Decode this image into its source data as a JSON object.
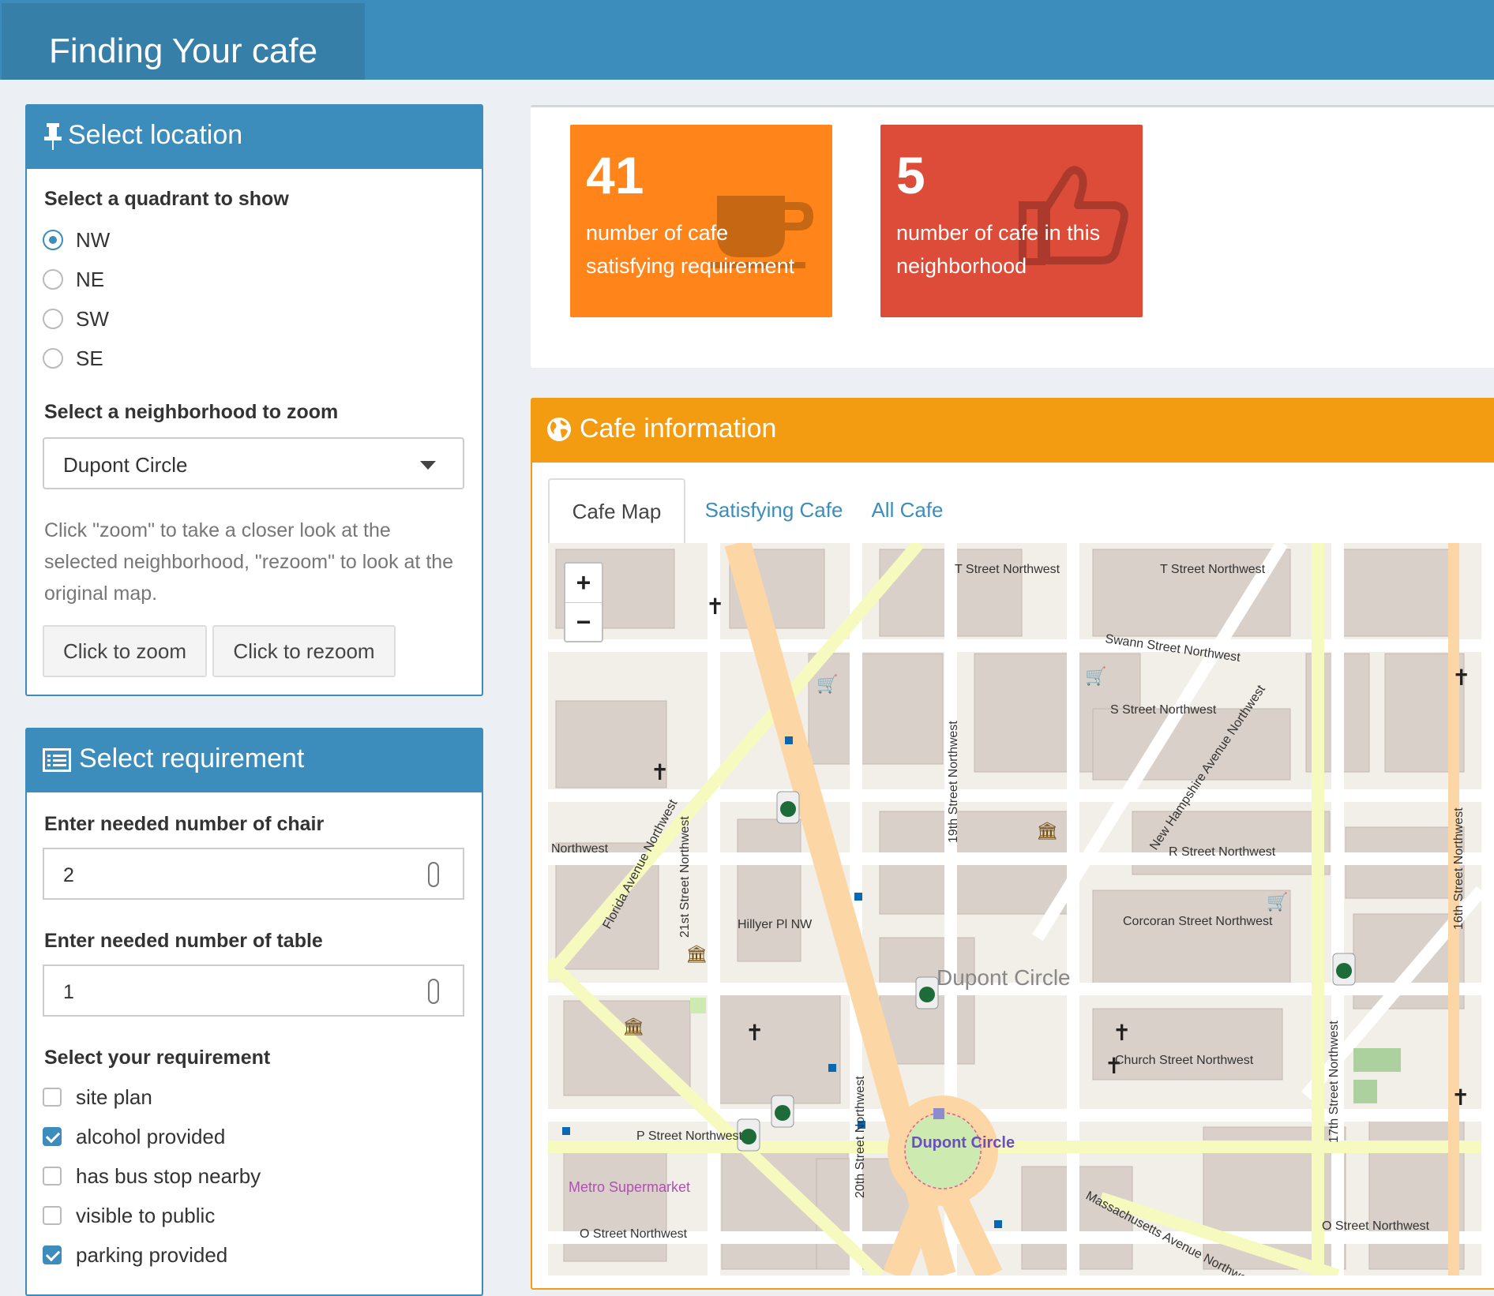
{
  "header": {
    "title": "Finding Your cafe"
  },
  "location_box": {
    "title": "Select location",
    "quadrant_label": "Select a quadrant to show",
    "quadrants": [
      {
        "label": "NW",
        "selected": true
      },
      {
        "label": "NE",
        "selected": false
      },
      {
        "label": "SW",
        "selected": false
      },
      {
        "label": "SE",
        "selected": false
      }
    ],
    "neighborhood_label": "Select a neighborhood to zoom",
    "neighborhood_value": "Dupont Circle",
    "help_text": "Click \"zoom\" to take a closer look at the selected neighborhood, \"rezoom\" to look at the original map.",
    "zoom_button": "Click to zoom",
    "rezoom_button": "Click to rezoom"
  },
  "requirement_box": {
    "title": "Select requirement",
    "chair_label": "Enter needed number of chair",
    "chair_value": "2",
    "table_label": "Enter needed number of table",
    "table_value": "1",
    "requirement_label": "Select your requirement",
    "requirements": [
      {
        "label": "site plan",
        "checked": false
      },
      {
        "label": "alcohol provided",
        "checked": true
      },
      {
        "label": "has bus stop nearby",
        "checked": false
      },
      {
        "label": "visible to public",
        "checked": false
      },
      {
        "label": "parking provided",
        "checked": true
      }
    ]
  },
  "value_boxes": [
    {
      "value": "41",
      "description": "number of cafe satisfying requirement",
      "color": "#ff851b",
      "icon": "coffee-cup-icon"
    },
    {
      "value": "5",
      "description": "number of cafe in this neighborhood",
      "color": "#dd4b39",
      "icon": "thumbs-up-icon"
    }
  ],
  "cafe_info": {
    "title": "Cafe information",
    "tabs": [
      {
        "label": "Cafe Map",
        "active": true
      },
      {
        "label": "Satisfying Cafe",
        "active": false
      },
      {
        "label": "All Cafe",
        "active": false
      }
    ],
    "map": {
      "zoom_in": "+",
      "zoom_out": "−",
      "street_labels": [
        "T Street Northwest",
        "T Street Northwest",
        "Swann Street Northwest",
        "S Street Northwest",
        "New Hampshire Avenue Northwest",
        "R Street Northwest",
        "Corcoran Street Northwest",
        "Church Street Northwest",
        "O Street Northwest",
        "O Street Northwest",
        "P Street Northwest",
        "Massachusetts Avenue Northwest",
        "Florida Avenue Northwest",
        "20th Street Northwest",
        "19th Street Northwest",
        "21st Street Northwest",
        "17th Street Northwest",
        "16th Street Northwest",
        "Hillyer Pl NW",
        "Northwest",
        "Dupont Circle",
        "Dupont Circle",
        "Metro Supermarket"
      ]
    }
  },
  "colors": {
    "header": "#3c8dbc",
    "header_logo": "#367fa9",
    "cafe_info_header": "#f39c12",
    "background": "#ecf0f5"
  }
}
